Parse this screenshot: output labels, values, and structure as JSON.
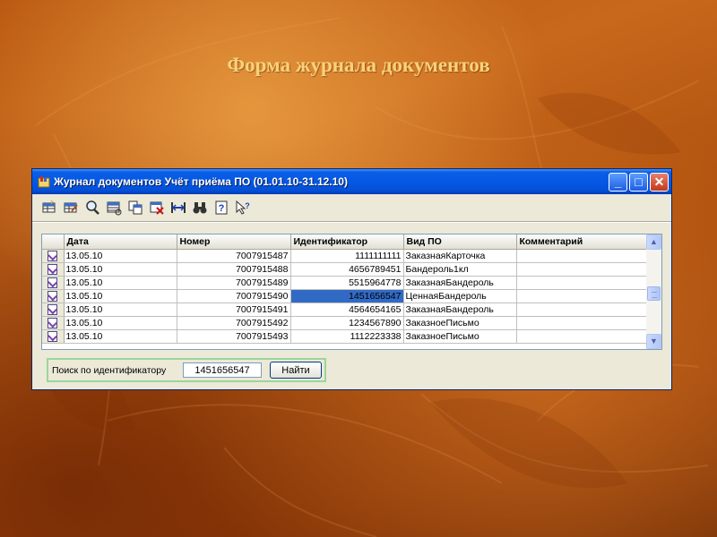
{
  "slide": {
    "title": "Форма журнала документов"
  },
  "window": {
    "title": "Журнал документов  Учёт приёма ПО (01.01.10-31.12.10)",
    "controls": {
      "minimize": "_",
      "maximize": "□",
      "close": "✕"
    }
  },
  "toolbar": {
    "icons": [
      "table-add-icon",
      "table-edit-icon",
      "magnify-icon",
      "table-view-icon",
      "copy-icon",
      "delete-icon",
      "column-width-icon",
      "binoculars-icon",
      "help-icon",
      "context-help-icon"
    ]
  },
  "grid": {
    "columns": [
      "Дата",
      "Номер",
      "Идентификатор",
      "Вид ПО",
      "Комментарий"
    ],
    "rows": [
      {
        "date": "13.05.10",
        "number": "7007915487",
        "id": "1111111111",
        "type": "ЗаказнаяКарточка",
        "comment": ""
      },
      {
        "date": "13.05.10",
        "number": "7007915488",
        "id": "4656789451",
        "type": "Бандероль1кл",
        "comment": ""
      },
      {
        "date": "13.05.10",
        "number": "7007915489",
        "id": "5515964778",
        "type": "ЗаказнаяБандероль",
        "comment": ""
      },
      {
        "date": "13.05.10",
        "number": "7007915490",
        "id": "1451656547",
        "type": "ЦеннаяБандероль",
        "comment": ""
      },
      {
        "date": "13.05.10",
        "number": "7007915491",
        "id": "4564654165",
        "type": "ЗаказнаяБандероль",
        "comment": ""
      },
      {
        "date": "13.05.10",
        "number": "7007915492",
        "id": "1234567890",
        "type": "ЗаказноеПисьмо",
        "comment": ""
      },
      {
        "date": "13.05.10",
        "number": "7007915493",
        "id": "1112223338",
        "type": "ЗаказноеПисьмо",
        "comment": ""
      }
    ],
    "selected_row": 3,
    "selected_column": "id"
  },
  "search": {
    "label": "Поиск по идентификатору",
    "value": "1451656547",
    "button_label": "Найти"
  },
  "colors": {
    "titlebar": "#0558e3",
    "selection": "#316ac5",
    "slide_title": "#f9d27a",
    "search_frame": "#9ad69a"
  }
}
